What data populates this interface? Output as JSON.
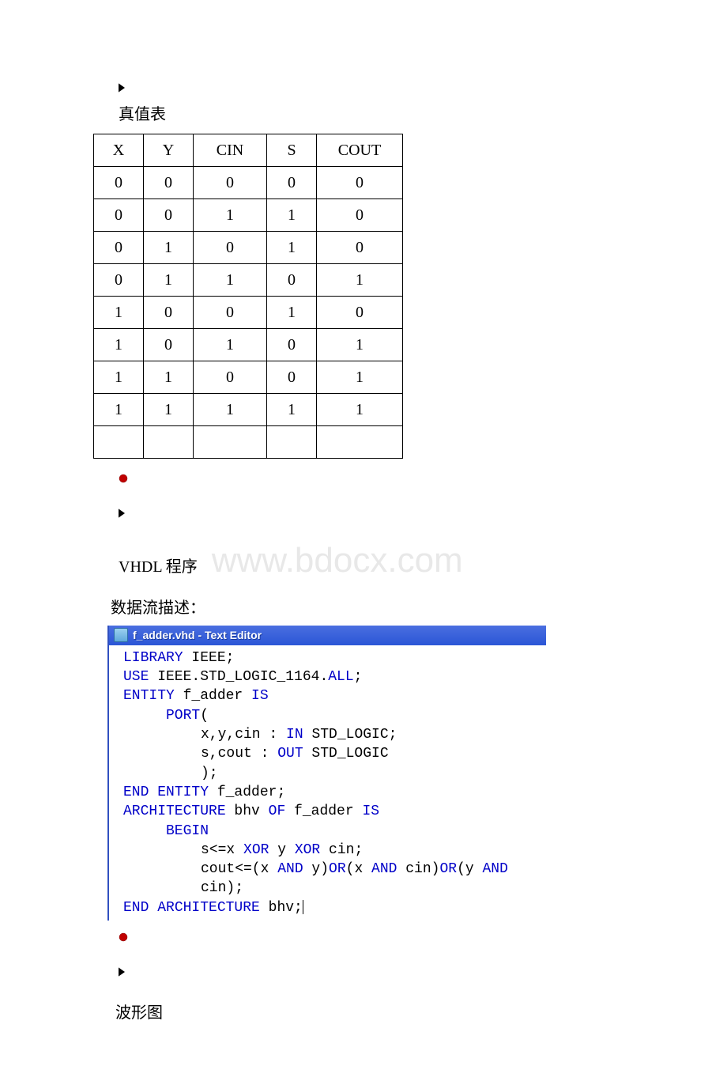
{
  "section_truth_label": "真值表",
  "truth_table": {
    "headers": [
      "X",
      "Y",
      "CIN",
      "S",
      "COUT"
    ],
    "rows": [
      [
        "0",
        "0",
        "0",
        "0",
        "0"
      ],
      [
        "0",
        "0",
        "1",
        "1",
        "0"
      ],
      [
        "0",
        "1",
        "0",
        "1",
        "0"
      ],
      [
        "0",
        "1",
        "1",
        "0",
        "1"
      ],
      [
        "1",
        "0",
        "0",
        "1",
        "0"
      ],
      [
        "1",
        "0",
        "1",
        "0",
        "1"
      ],
      [
        "1",
        "1",
        "0",
        "0",
        "1"
      ],
      [
        "1",
        "1",
        "1",
        "1",
        "1"
      ],
      [
        "",
        "",
        "",
        "",
        ""
      ]
    ]
  },
  "vhdl_label": "VHDL 程序",
  "watermark": "www.bdocx.com",
  "desc_label": "数据流描述：",
  "editor_title": "f_adder.vhd - Text Editor",
  "code": {
    "l1a": "LIBRARY",
    "l1b": " IEEE;",
    "l2a": "USE",
    "l2b": " IEEE.STD_LOGIC_1164.",
    "l2c": "ALL",
    "l2d": ";",
    "l3a": "ENTITY",
    "l3b": " f_adder ",
    "l3c": "IS",
    "l4a": "PORT",
    "l4b": "(",
    "l5a": "x,y,cin : ",
    "l5b": "IN",
    "l5c": " STD_LOGIC;",
    "l6a": "s,cout  : ",
    "l6b": "OUT",
    "l6c": " STD_LOGIC",
    "l7": ");",
    "l8a": "END",
    "l8b": " ",
    "l8c": "ENTITY",
    "l8d": " f_adder;",
    "l9a": "ARCHITECTURE",
    "l9b": " bhv ",
    "l9c": "OF",
    "l9d": " f_adder ",
    "l9e": "IS",
    "l10": "BEGIN",
    "l11a": "s<=x ",
    "l11b": "XOR",
    "l11c": " y ",
    "l11d": "XOR",
    "l11e": " cin;",
    "l12a": "cout<=(x ",
    "l12b": "AND",
    "l12c": " y)",
    "l12d": "OR",
    "l12e": "(x ",
    "l12f": "AND",
    "l12g": " cin)",
    "l12h": "OR",
    "l12i": "(y ",
    "l12j": "AND",
    "l12k": " cin);",
    "l13a": "END",
    "l13b": " ",
    "l13c": "ARCHITECTURE",
    "l13d": " bhv;"
  },
  "wave_label": "波形图"
}
